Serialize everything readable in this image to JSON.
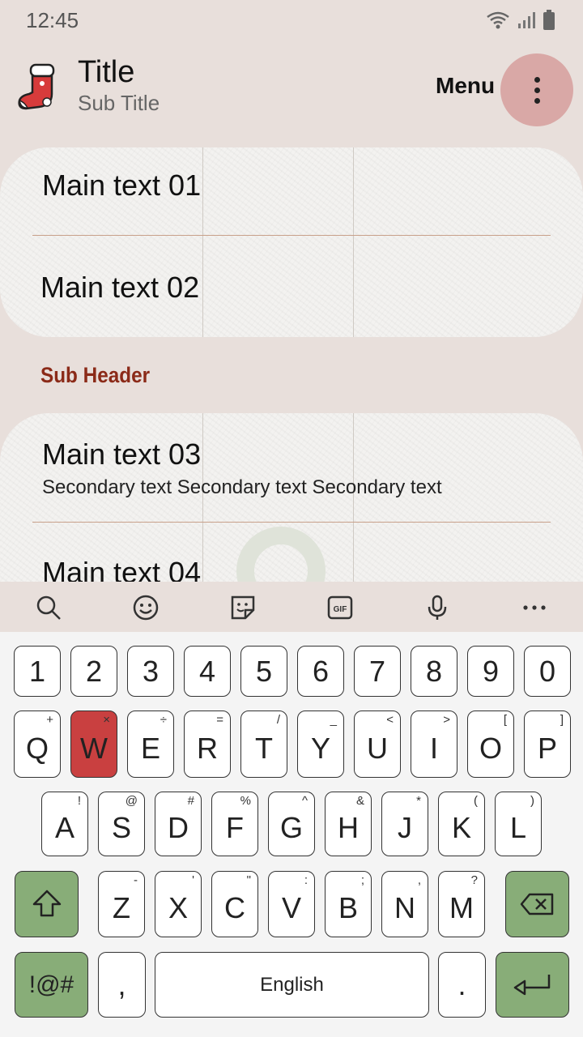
{
  "status_bar": {
    "time": "12:45"
  },
  "app_bar": {
    "title": "Title",
    "subtitle": "Sub Title",
    "menu_label": "Menu"
  },
  "list": {
    "items": [
      {
        "main": "Main text 01"
      },
      {
        "main": "Main text 02"
      },
      {
        "main": "Main text 03",
        "secondary": "Secondary text Secondary text Secondary text"
      },
      {
        "main": "Main text 04"
      }
    ],
    "sub_header": "Sub Header"
  },
  "keyboard": {
    "toolbar_icons": [
      "search-icon",
      "emoji-icon",
      "sticker-icon",
      "gif-icon",
      "mic-icon",
      "more-icon"
    ],
    "gif_label": "GIF",
    "number_row": [
      "1",
      "2",
      "3",
      "4",
      "5",
      "6",
      "7",
      "8",
      "9",
      "0"
    ],
    "row1": [
      {
        "k": "Q",
        "s": "+"
      },
      {
        "k": "W",
        "s": "×"
      },
      {
        "k": "E",
        "s": "÷"
      },
      {
        "k": "R",
        "s": "="
      },
      {
        "k": "T",
        "s": "/"
      },
      {
        "k": "Y",
        "s": "_"
      },
      {
        "k": "U",
        "s": "<"
      },
      {
        "k": "I",
        "s": ">"
      },
      {
        "k": "O",
        "s": "["
      },
      {
        "k": "P",
        "s": "]"
      }
    ],
    "row2": [
      {
        "k": "A",
        "s": "!"
      },
      {
        "k": "S",
        "s": "@"
      },
      {
        "k": "D",
        "s": "#"
      },
      {
        "k": "F",
        "s": "%"
      },
      {
        "k": "G",
        "s": "^"
      },
      {
        "k": "H",
        "s": "&"
      },
      {
        "k": "J",
        "s": "*"
      },
      {
        "k": "K",
        "s": "("
      },
      {
        "k": "L",
        "s": ")"
      }
    ],
    "row3": [
      {
        "k": "Z",
        "s": "-"
      },
      {
        "k": "X",
        "s": "'"
      },
      {
        "k": "C",
        "s": "\""
      },
      {
        "k": "V",
        "s": ":"
      },
      {
        "k": "B",
        "s": ";"
      },
      {
        "k": "N",
        "s": ","
      },
      {
        "k": "M",
        "s": "?"
      }
    ],
    "symbols_label": "!@#",
    "comma_label": ",",
    "space_label": "English",
    "period_label": ".",
    "colors": {
      "highlight_key": "#c94040",
      "function_key": "#88ad78",
      "menu_button": "#d9a8a6",
      "sub_header": "#8b2a18"
    }
  }
}
